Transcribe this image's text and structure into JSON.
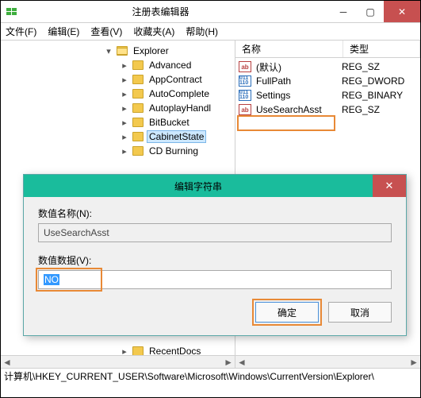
{
  "window": {
    "title": "注册表编辑器"
  },
  "menu": {
    "file": "文件(F)",
    "edit": "编辑(E)",
    "view": "查看(V)",
    "favorites": "收藏夹(A)",
    "help": "帮助(H)"
  },
  "tree": {
    "root": "Explorer",
    "children": [
      "Advanced",
      "AppContract",
      "AutoComplete",
      "AutoplayHandl",
      "BitBucket",
      "CabinetState",
      "CD Burning",
      "RecentDocs"
    ],
    "selected": "CabinetState"
  },
  "list": {
    "cols": {
      "name": "名称",
      "type": "类型"
    },
    "rows": [
      {
        "name": "(默认)",
        "type": "REG_SZ",
        "icon": "str"
      },
      {
        "name": "FullPath",
        "type": "REG_DWORD",
        "icon": "bin"
      },
      {
        "name": "Settings",
        "type": "REG_BINARY",
        "icon": "bin"
      },
      {
        "name": "UseSearchAsst",
        "type": "REG_SZ",
        "icon": "str"
      }
    ]
  },
  "status": {
    "path": "计算机\\HKEY_CURRENT_USER\\Software\\Microsoft\\Windows\\CurrentVersion\\Explorer\\"
  },
  "dialog": {
    "title": "编辑字符串",
    "name_label": "数值名称(N):",
    "name_value": "UseSearchAsst",
    "data_label": "数值数据(V):",
    "data_value": "NO",
    "ok": "确定",
    "cancel": "取消"
  }
}
